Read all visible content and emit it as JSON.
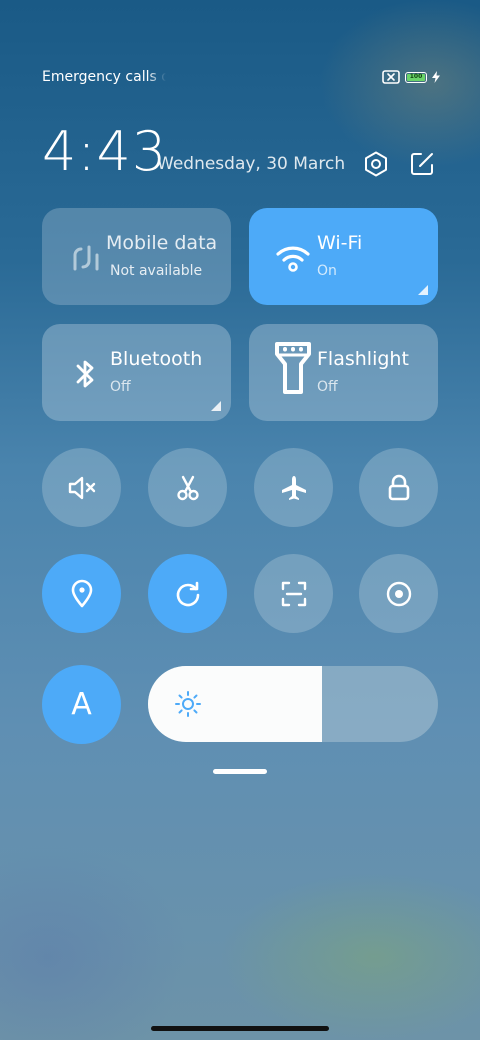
{
  "status_bar": {
    "carrier_text": "Emergency calls only",
    "battery_level": "100",
    "icons": [
      "no-sim-icon",
      "battery-icon",
      "charging-icon"
    ]
  },
  "header": {
    "time": "4:43",
    "date": "Wednesday, 30 March",
    "icons": [
      "settings-icon",
      "edit-icon"
    ]
  },
  "tiles": [
    {
      "id": "mobile-data",
      "name": "Mobile data",
      "state": "Not available",
      "active": false,
      "icon": "mobile-data-icon"
    },
    {
      "id": "wifi",
      "name": "Wi-Fi",
      "state": "On",
      "active": true,
      "icon": "wifi-icon"
    },
    {
      "id": "bluetooth",
      "name": "Bluetooth",
      "state": "Off",
      "active": false,
      "icon": "bluetooth-icon"
    },
    {
      "id": "flashlight",
      "name": "Flashlight",
      "state": "Off",
      "active": false,
      "icon": "flashlight-icon"
    }
  ],
  "toggles_row1": [
    {
      "id": "mute",
      "icon": "mute-icon",
      "active": false
    },
    {
      "id": "screenshot",
      "icon": "scissors-icon",
      "active": false
    },
    {
      "id": "airplane",
      "icon": "airplane-icon",
      "active": false
    },
    {
      "id": "lock-screen",
      "icon": "lock-icon",
      "active": false
    }
  ],
  "toggles_row2": [
    {
      "id": "location",
      "icon": "location-pin-icon",
      "active": true
    },
    {
      "id": "auto-rotate",
      "icon": "rotate-icon",
      "active": true
    },
    {
      "id": "scanner",
      "icon": "scan-icon",
      "active": false
    },
    {
      "id": "reading-mode",
      "icon": "eye-icon",
      "active": false
    }
  ],
  "auto_brightness": {
    "label": "A",
    "active": true
  },
  "brightness": {
    "level_percent": 60,
    "icon": "sun-icon"
  },
  "colors": {
    "accent": "#4daaf8",
    "tile_bg": "rgba(190,210,225,0.38)",
    "text": "#ffffff"
  }
}
